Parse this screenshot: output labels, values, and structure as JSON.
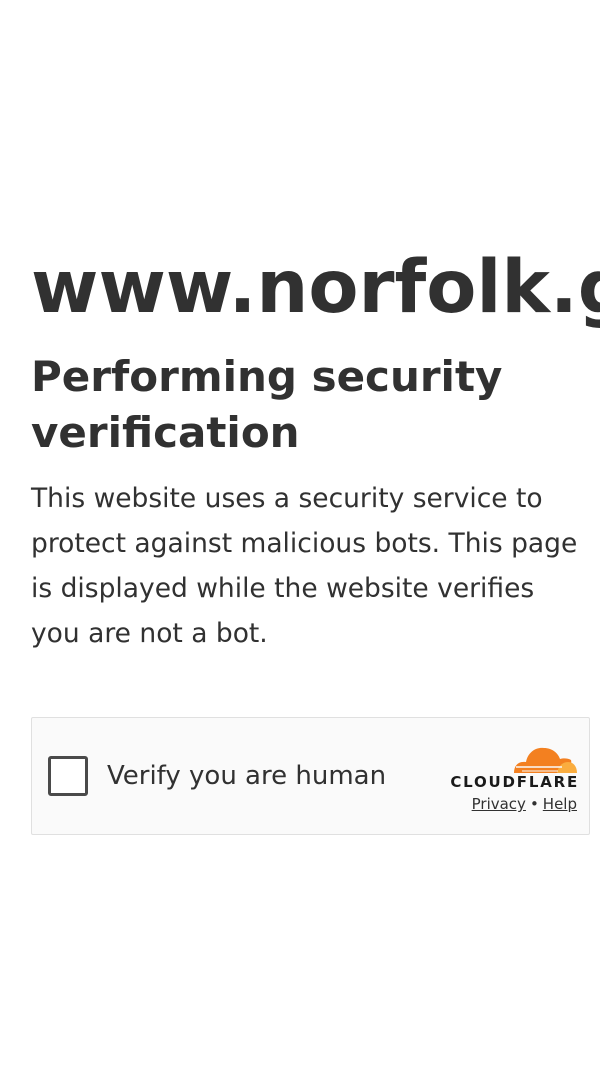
{
  "page": {
    "domain": "www.norfolk.gov",
    "title": "Performing security verification",
    "description": "This website uses a security service to protect against malicious bots. This page is displayed while the website verifies you are not a bot."
  },
  "widget": {
    "checkbox_label": "Verify you are human",
    "checked": false,
    "brand": "CLOUDFLARE",
    "privacy_link": "Privacy",
    "separator": "•",
    "help_link": "Help",
    "colors": {
      "brand_orange": "#f38020",
      "brand_orange_light": "#faad3f",
      "background": "#fafafa",
      "border": "#e0e0e0"
    }
  }
}
